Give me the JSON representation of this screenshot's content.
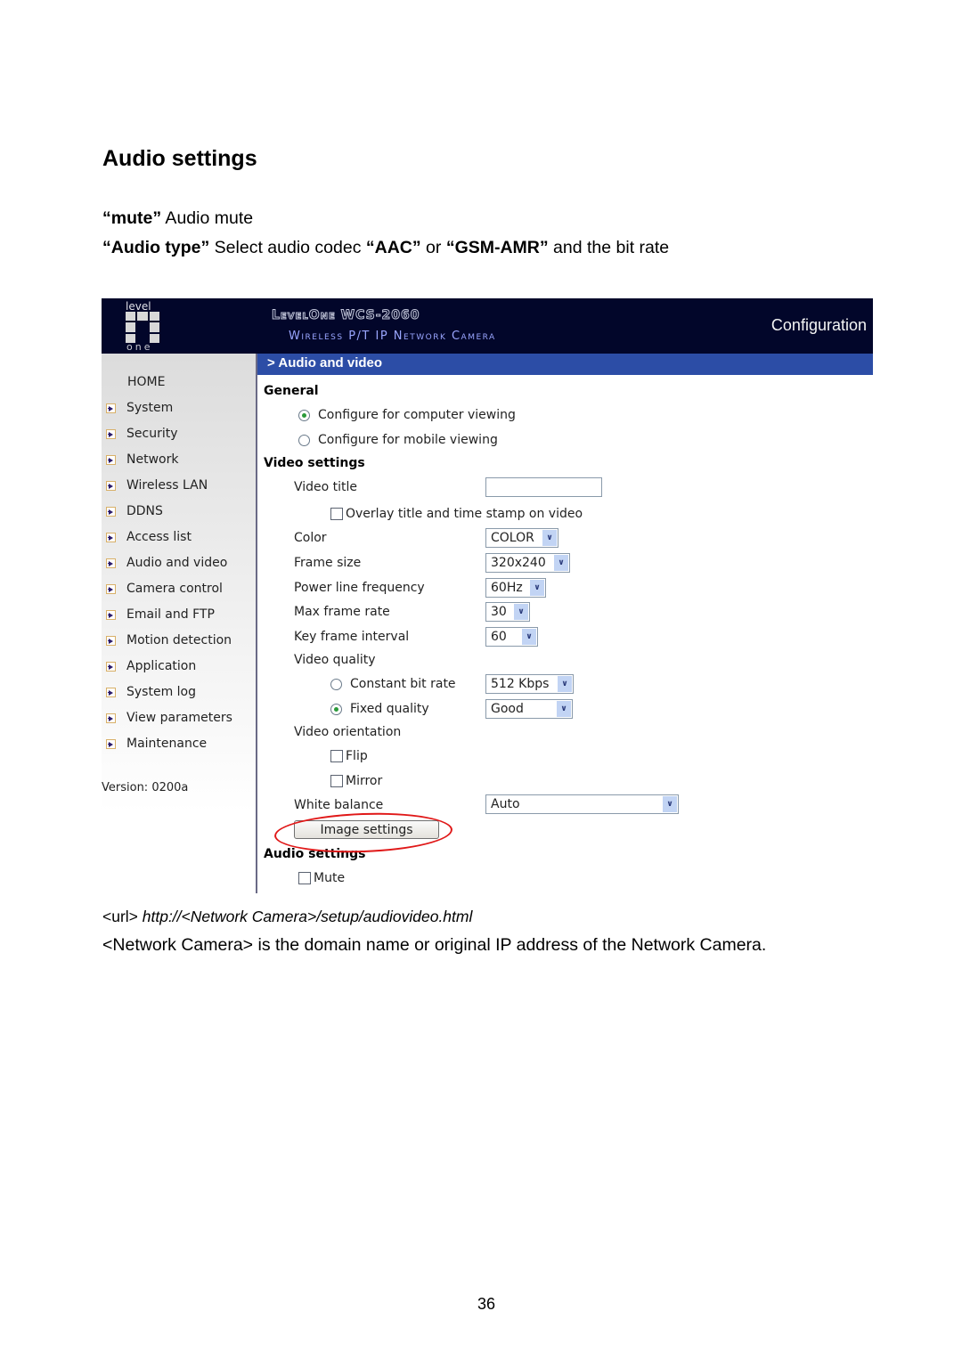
{
  "doc": {
    "heading": "Audio settings",
    "mute_line": {
      "term": "“mute”",
      "desc": " Audio mute"
    },
    "audiotype_line": {
      "term": "“Audio type”",
      "text1": " Select audio codec ",
      "codec1": "“AAC”",
      "text2": " or ",
      "codec2": "“GSM-AMR”",
      "text3": " and the bit rate"
    },
    "url_line": {
      "prefix": "<url> ",
      "url": "http://<Network Camera>/setup/audiovideo.html"
    },
    "note": "<Network Camera> is the domain name or original IP address of the Network Camera.",
    "page_number": "36"
  },
  "camera_ui": {
    "header": {
      "logo_top": "level",
      "logo_bottom": "one",
      "brand_line1": "LevelOne WCS-2060",
      "brand_line2": "Wireless P/T IP Network Camera",
      "section": "Configuration"
    },
    "sidebar": {
      "home": "HOME",
      "items": [
        {
          "label": "System"
        },
        {
          "label": "Security"
        },
        {
          "label": "Network"
        },
        {
          "label": "Wireless LAN"
        },
        {
          "label": "DDNS"
        },
        {
          "label": "Access list"
        },
        {
          "label": "Audio and video"
        },
        {
          "label": "Camera control"
        },
        {
          "label": "Email and FTP"
        },
        {
          "label": "Motion detection"
        },
        {
          "label": "Application"
        },
        {
          "label": "System log"
        },
        {
          "label": "View parameters"
        },
        {
          "label": "Maintenance"
        }
      ],
      "version": "Version: 0200a"
    },
    "page_title": "> Audio and video",
    "general": {
      "title": "General",
      "options": [
        {
          "label": "Configure for computer viewing",
          "selected": true
        },
        {
          "label": "Configure for mobile viewing",
          "selected": false
        }
      ]
    },
    "video_settings": {
      "title": "Video settings",
      "video_title_label": "Video title",
      "video_title_value": "",
      "overlay_label": "Overlay title and time stamp on video",
      "overlay_checked": false,
      "color_label": "Color",
      "color_value": "COLOR",
      "frame_size_label": "Frame size",
      "frame_size_value": "320x240",
      "power_line_label": "Power line frequency",
      "power_line_value": "60Hz",
      "max_frame_rate_label": "Max frame rate",
      "max_frame_rate_value": "30",
      "key_frame_label": "Key frame interval",
      "key_frame_value": "60",
      "video_quality_label": "Video quality",
      "cbr_label": "Constant bit rate",
      "cbr_selected": false,
      "cbr_value": "512 Kbps",
      "fixed_label": "Fixed quality",
      "fixed_selected": true,
      "fixed_value": "Good",
      "orientation_label": "Video orientation",
      "flip_label": "Flip",
      "flip_checked": false,
      "mirror_label": "Mirror",
      "mirror_checked": false,
      "white_balance_label": "White balance",
      "white_balance_value": "Auto",
      "image_settings_button": "Image settings"
    },
    "audio_settings": {
      "title": "Audio settings",
      "mute_label": "Mute",
      "mute_checked": false
    },
    "colors": {
      "header_bg": "#02062a",
      "title_bar": "#2c4da6",
      "annotation": "#e01818"
    }
  }
}
